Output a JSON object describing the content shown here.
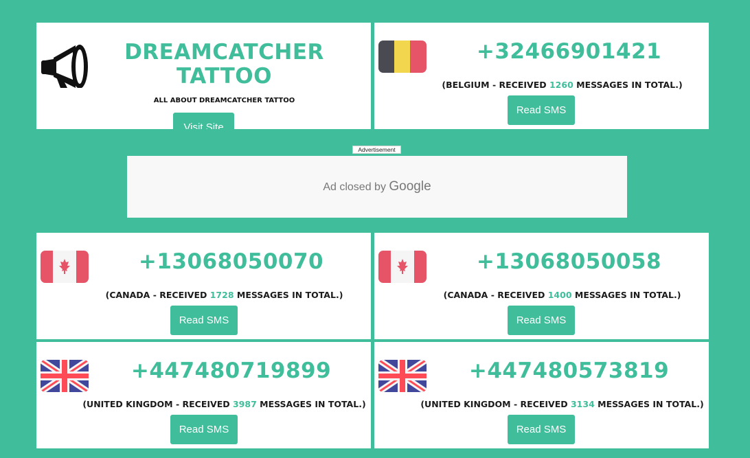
{
  "promo": {
    "title_line1": "DREAMCATCHER",
    "title_line2": "TATTOO",
    "subtitle": "ALL ABOUT DREAMCATCHER TATTOO",
    "button": "Visit Site",
    "icon": "megaphone-icon"
  },
  "ad": {
    "label": "Advertisement",
    "closed_text": "Ad closed by",
    "brand": "Google"
  },
  "numbers": [
    {
      "phone": "+32466901421",
      "country": "BELGIUM",
      "count": "1260",
      "flag": "belgium",
      "button": "Read SMS"
    },
    {
      "phone": "+13068050070",
      "country": "CANADA",
      "count": "1728",
      "flag": "canada",
      "button": "Read SMS"
    },
    {
      "phone": "+13068050058",
      "country": "CANADA",
      "count": "1400",
      "flag": "canada",
      "button": "Read SMS"
    },
    {
      "phone": "+447480719899",
      "country": "UNITED KINGDOM",
      "count": "3987",
      "flag": "uk",
      "button": "Read SMS"
    },
    {
      "phone": "+447480573819",
      "country": "UNITED KINGDOM",
      "count": "3134",
      "flag": "uk",
      "button": "Read SMS"
    }
  ],
  "text": {
    "prefix": "(",
    "received": " - RECEIVED ",
    "suffix": " MESSAGES IN TOTAL.)"
  },
  "colors": {
    "accent": "#40bd9a",
    "belgium_black": "#4a4a52",
    "belgium_yellow": "#f2d74e",
    "belgium_red": "#e55467",
    "canada_red": "#e55467",
    "uk_blue": "#41479b",
    "uk_red": "#ff4b55"
  }
}
